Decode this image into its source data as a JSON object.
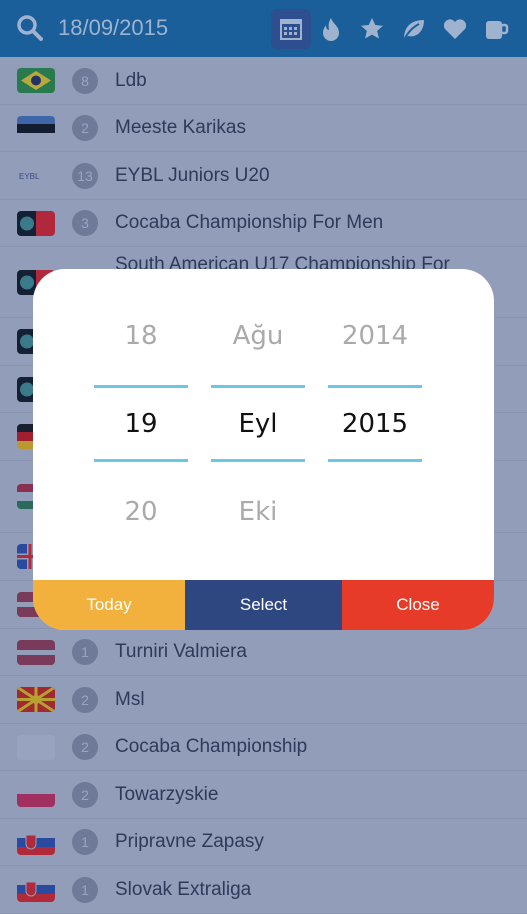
{
  "header": {
    "date": "18/09/2015",
    "icons": [
      "calendar-icon",
      "fire-icon",
      "star-icon",
      "leaf-icon",
      "heart-icon",
      "mug-icon"
    ],
    "active_icon": "calendar-icon"
  },
  "rows": [
    {
      "flag": "brazil",
      "count": "8",
      "name": "Ldb"
    },
    {
      "flag": "estonia",
      "count": "2",
      "name": "Meeste Karikas"
    },
    {
      "flag": "eybl",
      "count": "13",
      "name": "EYBL Juniors U20"
    },
    {
      "flag": "fiba",
      "count": "3",
      "name": "Cocaba Championship For Men"
    },
    {
      "flag": "fiba",
      "count": "",
      "name": "South American U17 Championship For"
    },
    {
      "flag": "fiba",
      "count": "",
      "name": ""
    },
    {
      "flag": "fiba",
      "count": "",
      "name": ""
    },
    {
      "flag": "germany",
      "count": "",
      "name": ""
    },
    {
      "flag": "hungary",
      "count": "",
      "name": ""
    },
    {
      "flag": "iceland",
      "count": "",
      "name": ""
    },
    {
      "flag": "latvia",
      "count": "",
      "name": ""
    },
    {
      "flag": "latvia",
      "count": "1",
      "name": "Turniri Valmiera"
    },
    {
      "flag": "macedonia",
      "count": "2",
      "name": "Msl"
    },
    {
      "flag": "none",
      "count": "2",
      "name": "Cocaba Championship"
    },
    {
      "flag": "poland",
      "count": "2",
      "name": "Towarzyskie"
    },
    {
      "flag": "slovakia",
      "count": "1",
      "name": "Pripravne Zapasy"
    },
    {
      "flag": "slovakia",
      "count": "1",
      "name": "Slovak Extraliga"
    }
  ],
  "picker": {
    "day": {
      "prev": "18",
      "selected": "19",
      "next": "20"
    },
    "month": {
      "prev": "Ağu",
      "selected": "Eyl",
      "next": "Eki"
    },
    "year": {
      "prev": "2014",
      "selected": "2015",
      "next": ""
    },
    "today_label": "Today",
    "select_label": "Select",
    "close_label": "Close"
  },
  "colors": {
    "header": "#1a5e9a",
    "today": "#f2b03c",
    "select": "#2f4780",
    "close": "#e63b28",
    "divider": "#6ec6e6"
  }
}
